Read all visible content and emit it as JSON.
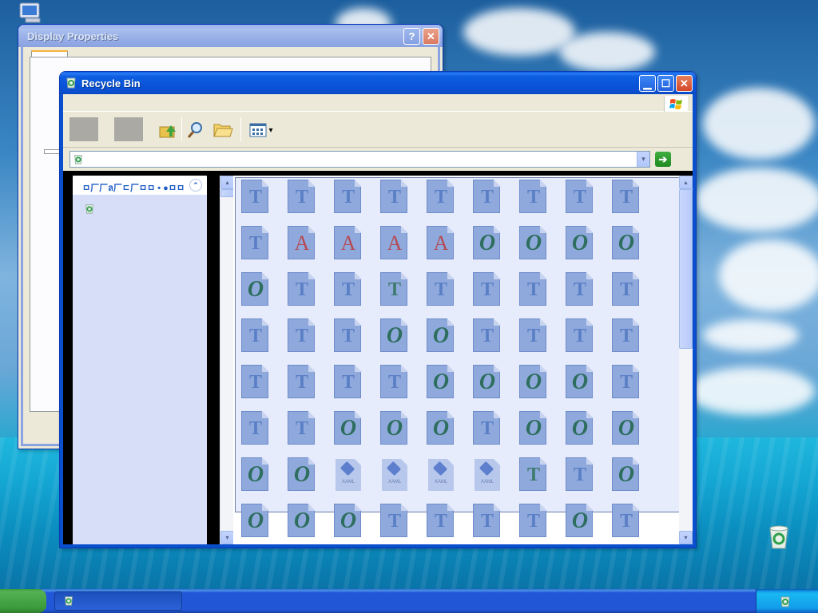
{
  "desktop": {
    "icons": [
      "my-computer-icon",
      "recycle-bin-icon"
    ]
  },
  "display_properties": {
    "title": "Display Properties",
    "help_glyph": "?",
    "close_glyph": "✕"
  },
  "recycle_bin": {
    "title": "Recycle Bin",
    "minimize_glyph": "▁",
    "maximize_glyph": "☐",
    "close_glyph": "✕",
    "toolbar": {
      "icons": [
        "back-icon",
        "forward-icon",
        "up-folder-icon",
        "search-icon",
        "folders-icon",
        "views-icon"
      ],
      "views_arrow": "▾"
    },
    "address": {
      "value": "",
      "dropdown_glyph": "▾",
      "go_glyph": "➔"
    },
    "task_pane": {
      "heading": "ㅁ厂厂ล厂ㄷ厂ㅁㅁ • ●ㅁㅁ",
      "collapse_glyph": "⌃"
    },
    "scroll": {
      "up_glyph": "▴",
      "down_glyph": "▾"
    },
    "files": [
      "T",
      "T",
      "T",
      "T",
      "T",
      "T",
      "T",
      "T",
      "T",
      "T",
      "A",
      "A",
      "A",
      "A",
      "O",
      "O",
      "O",
      "O",
      "O",
      "T",
      "T",
      "T2",
      "T",
      "T",
      "T",
      "T",
      "T",
      "T",
      "T",
      "T",
      "O",
      "O",
      "T",
      "T",
      "T",
      "T",
      "T",
      "T",
      "T",
      "T",
      "O",
      "O",
      "O",
      "O",
      "T",
      "T",
      "T",
      "O",
      "O",
      "O",
      "T",
      "O",
      "O",
      "O",
      "O",
      "O",
      "XAML",
      "XAML",
      "XAML",
      "XAML",
      "T2",
      "T",
      "O",
      "O",
      "O",
      "O",
      "T",
      "T",
      "T",
      "T",
      "O",
      "T"
    ],
    "xaml_label": "XAML"
  },
  "taskbar": {
    "active_task_icon": "recycle-bin-icon",
    "tray_icons": [
      "keyboard-icon",
      "network-icon"
    ]
  }
}
